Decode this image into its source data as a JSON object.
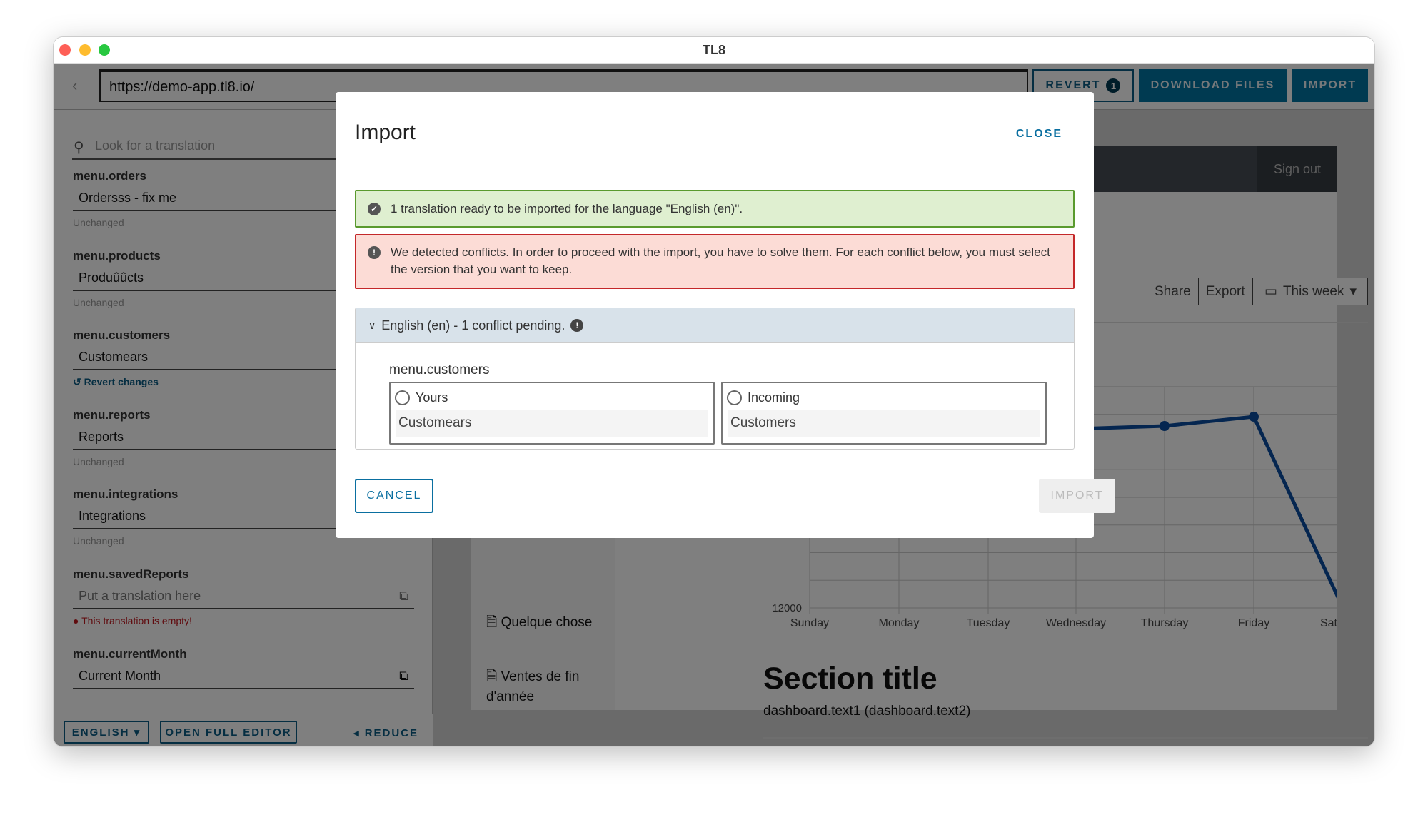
{
  "window": {
    "title": "TL8"
  },
  "toolbar": {
    "url": "https://demo-app.tl8.io/",
    "revert_label": "REVERT",
    "revert_count": "1",
    "download_label": "DOWNLOAD FILES",
    "import_label": "IMPORT"
  },
  "sidebar": {
    "search_placeholder": "Look for a translation",
    "items": [
      {
        "key": "menu.orders",
        "value": "Ordersss - fix me",
        "status": "Unchanged"
      },
      {
        "key": "menu.products",
        "value": "Produûûcts",
        "status": "Unchanged"
      },
      {
        "key": "menu.customers",
        "value": "Customears",
        "status": "Revert changes"
      },
      {
        "key": "menu.reports",
        "value": "Reports",
        "status": "Unchanged"
      },
      {
        "key": "menu.integrations",
        "value": "Integrations",
        "status": "Unchanged"
      },
      {
        "key": "menu.savedReports",
        "value": "",
        "placeholder": "Put a translation here",
        "status": "This translation is empty!"
      },
      {
        "key": "menu.currentMonth",
        "value": "Current Month"
      }
    ],
    "footer": {
      "language": "ENGLISH",
      "open_editor": "OPEN FULL EDITOR",
      "reduce": "REDUCE"
    }
  },
  "app": {
    "signout": "Sign out",
    "share": "Share",
    "export": "Export",
    "period": "This week",
    "nav": [
      "Quelque chose",
      "Ventes de fin d'année"
    ],
    "chart": {
      "y_tick": "12000",
      "x_labels": [
        "Sunday",
        "Monday",
        "Tuesday",
        "Wednesday",
        "Thursday",
        "Friday",
        "Saturday"
      ],
      "line_color": "#0a4da0"
    },
    "section_title": "Section title",
    "section_text": "dashboard.text1 (dashboard.text2)",
    "table_headers": [
      "#",
      "Header",
      "Header",
      "Header",
      "Header"
    ]
  },
  "modal": {
    "title": "Import",
    "close": "CLOSE",
    "success": "1 translation ready to be imported for the language \"English (en)\".",
    "error": "We detected conflicts. In order to proceed with the import, you have to solve them. For each conflict below, you must select the version that you want to keep.",
    "accordion": "English (en) - 1 conflict pending.",
    "conflict_key": "menu.customers",
    "yours_label": "Yours",
    "yours_value": "Customears",
    "incoming_label": "Incoming",
    "incoming_value": "Customers",
    "cancel": "CANCEL",
    "import": "IMPORT"
  }
}
